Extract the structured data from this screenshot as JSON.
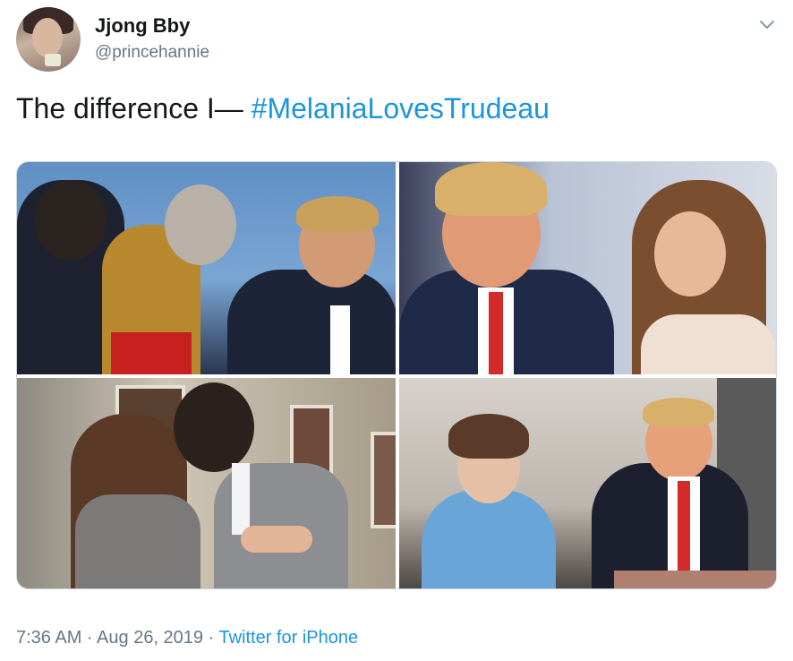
{
  "tweet": {
    "display_name": "Jjong Bby",
    "handle": "@princehannie",
    "text_prefix": "The difference I— ",
    "hashtag": "#MelaniaLovesTrudeau",
    "timestamp": "7:36 AM · Aug 26, 2019 · ",
    "source": "Twitter for iPhone",
    "menu_icon": "chevron-down-icon",
    "hashtag_color": "#1b95e0"
  }
}
